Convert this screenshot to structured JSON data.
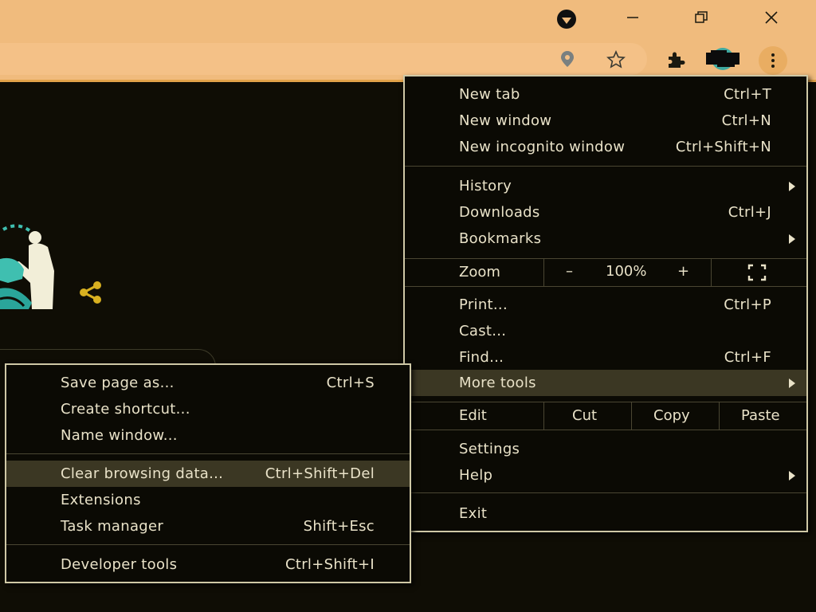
{
  "window": {
    "controls": [
      "minimize",
      "restore",
      "close"
    ]
  },
  "toolbar": {
    "icons": [
      "location-icon",
      "star-icon",
      "extensions-icon",
      "profile-avatar",
      "menu-kebab-icon"
    ]
  },
  "main_menu": {
    "new_tab": {
      "label": "New tab",
      "shortcut": "Ctrl+T"
    },
    "new_window": {
      "label": "New window",
      "shortcut": "Ctrl+N"
    },
    "new_incognito": {
      "label": "New incognito window",
      "shortcut": "Ctrl+Shift+N"
    },
    "history": {
      "label": "History"
    },
    "downloads": {
      "label": "Downloads",
      "shortcut": "Ctrl+J"
    },
    "bookmarks": {
      "label": "Bookmarks"
    },
    "zoom": {
      "label": "Zoom",
      "minus": "–",
      "value": "100%",
      "plus": "+"
    },
    "print": {
      "label": "Print...",
      "shortcut": "Ctrl+P"
    },
    "cast": {
      "label": "Cast..."
    },
    "find": {
      "label": "Find...",
      "shortcut": "Ctrl+F"
    },
    "more_tools": {
      "label": "More tools"
    },
    "edit": {
      "label": "Edit",
      "cut": "Cut",
      "copy": "Copy",
      "paste": "Paste"
    },
    "settings": {
      "label": "Settings"
    },
    "help": {
      "label": "Help"
    },
    "exit": {
      "label": "Exit"
    }
  },
  "sub_menu": {
    "save_page": {
      "label": "Save page as...",
      "shortcut": "Ctrl+S"
    },
    "create_shortcut": {
      "label": "Create shortcut..."
    },
    "name_window": {
      "label": "Name window..."
    },
    "clear_browsing": {
      "label": "Clear browsing data...",
      "shortcut": "Ctrl+Shift+Del"
    },
    "extensions": {
      "label": "Extensions"
    },
    "task_manager": {
      "label": "Task manager",
      "shortcut": "Shift+Esc"
    },
    "dev_tools": {
      "label": "Developer tools",
      "shortcut": "Ctrl+Shift+I"
    }
  },
  "colors": {
    "chrome_bg": "#f0bb7d",
    "page_bg": "#0f0d05",
    "menu_bg": "#0b0a04",
    "menu_text": "#e9e2c8",
    "highlight": "#3b3723",
    "share_icon": "#d8b020"
  }
}
